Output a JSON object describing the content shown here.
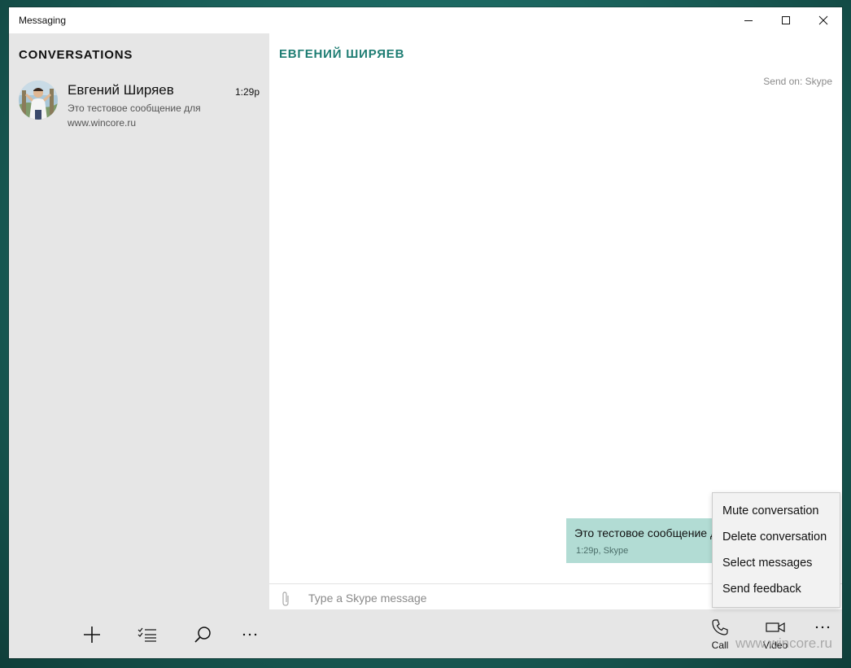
{
  "window": {
    "title": "Messaging",
    "controls": [
      "minimize-icon",
      "maximize-icon",
      "close-icon"
    ]
  },
  "sidebar": {
    "heading": "CONVERSATIONS",
    "conversations": [
      {
        "name": "Евгений Ширяев",
        "time": "1:29p",
        "preview": "Это тестовое сообщение для www.wincore.ru",
        "avatar": "contact-photo"
      }
    ],
    "bottom_bar": [
      "add-icon",
      "select-list-icon",
      "search-icon",
      "more-icon"
    ]
  },
  "main": {
    "contact_title": "ЕВГЕНИЙ ШИРЯЕВ",
    "send_on": "Send on: Skype",
    "messages": [
      {
        "text": "Это тестовое сообщение для www.wincore.ru",
        "meta": "1:29p, Skype"
      }
    ],
    "compose": {
      "placeholder": "Type a Skype message",
      "value": ""
    },
    "actions": {
      "call_label": "Call",
      "video_label": "Video"
    }
  },
  "context_menu": {
    "items": [
      "Mute conversation",
      "Delete conversation",
      "Select messages",
      "Send feedback"
    ]
  },
  "watermark": "www.wincore.ru",
  "colors": {
    "accent": "#1e7d73",
    "bubble": "#b2dcd4",
    "sidebar_bg": "#e6e6e6",
    "desktop": "#1d6a63"
  }
}
